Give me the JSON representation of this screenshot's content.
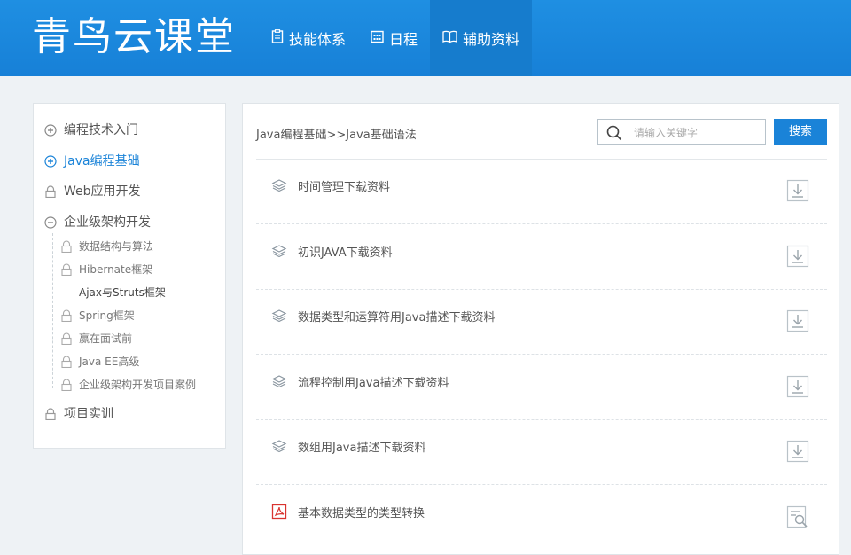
{
  "header": {
    "logo": "青鸟云课堂",
    "nav": [
      {
        "label": "技能体系",
        "icon": "document-icon"
      },
      {
        "label": "日程",
        "icon": "calendar-icon"
      },
      {
        "label": "辅助资料",
        "icon": "book-icon"
      }
    ]
  },
  "sidebar": {
    "items": [
      {
        "label": "编程技术入门",
        "icon": "plus-circle-icon",
        "level": 1
      },
      {
        "label": "Java编程基础",
        "icon": "plus-circle-icon",
        "level": 1,
        "active": true
      },
      {
        "label": "Web应用开发",
        "icon": "lock-icon",
        "level": 1
      },
      {
        "label": "企业级架构开发",
        "icon": "minus-circle-icon",
        "level": 1
      },
      {
        "label": "数据结构与算法",
        "icon": "lock-icon",
        "level": 2
      },
      {
        "label": "Hibernate框架",
        "icon": "lock-icon",
        "level": 2
      },
      {
        "label": "Ajax与Struts框架",
        "icon": "",
        "level": 2
      },
      {
        "label": "Spring框架",
        "icon": "lock-icon",
        "level": 2
      },
      {
        "label": "赢在面试前",
        "icon": "lock-icon",
        "level": 2
      },
      {
        "label": "Java EE高级",
        "icon": "lock-icon",
        "level": 2
      },
      {
        "label": "企业级架构开发项目案例",
        "icon": "lock-icon",
        "level": 2
      },
      {
        "label": "项目实训",
        "icon": "lock-icon",
        "level": 1
      }
    ]
  },
  "main": {
    "breadcrumb": "Java编程基础>>Java基础语法",
    "search": {
      "placeholder": "请输入关键字",
      "button": "搜索"
    },
    "rows": [
      {
        "title": "时间管理下载资料",
        "icon": "layers-icon",
        "action": "download-icon"
      },
      {
        "title": "初识JAVA下载资料",
        "icon": "layers-icon",
        "action": "download-icon"
      },
      {
        "title": "数据类型和运算符用Java描述下载资料",
        "icon": "layers-icon",
        "action": "download-icon"
      },
      {
        "title": "流程控制用Java描述下载资料",
        "icon": "layers-icon",
        "action": "download-icon"
      },
      {
        "title": "数组用Java描述下载资料",
        "icon": "layers-icon",
        "action": "download-icon"
      },
      {
        "title": "基本数据类型的类型转换",
        "icon": "pdf-icon",
        "action": "preview-icon"
      }
    ]
  },
  "colors": {
    "header": "#1780d7",
    "accent": "#1a83d8",
    "pdf": "#d9332f"
  }
}
